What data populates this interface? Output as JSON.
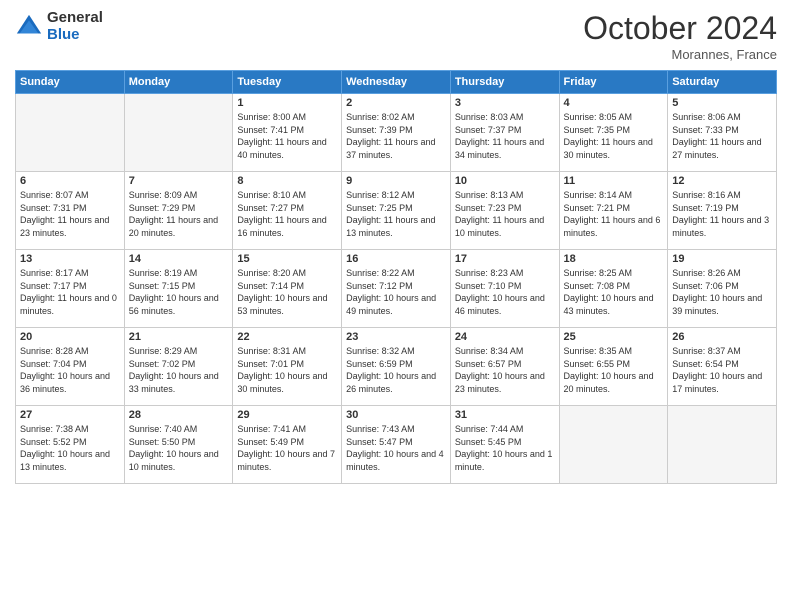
{
  "logo": {
    "general": "General",
    "blue": "Blue"
  },
  "title": "October 2024",
  "location": "Morannes, France",
  "days_header": [
    "Sunday",
    "Monday",
    "Tuesday",
    "Wednesday",
    "Thursday",
    "Friday",
    "Saturday"
  ],
  "weeks": [
    [
      {
        "day": "",
        "sunrise": "",
        "sunset": "",
        "daylight": ""
      },
      {
        "day": "",
        "sunrise": "",
        "sunset": "",
        "daylight": ""
      },
      {
        "day": "1",
        "sunrise": "Sunrise: 8:00 AM",
        "sunset": "Sunset: 7:41 PM",
        "daylight": "Daylight: 11 hours and 40 minutes."
      },
      {
        "day": "2",
        "sunrise": "Sunrise: 8:02 AM",
        "sunset": "Sunset: 7:39 PM",
        "daylight": "Daylight: 11 hours and 37 minutes."
      },
      {
        "day": "3",
        "sunrise": "Sunrise: 8:03 AM",
        "sunset": "Sunset: 7:37 PM",
        "daylight": "Daylight: 11 hours and 34 minutes."
      },
      {
        "day": "4",
        "sunrise": "Sunrise: 8:05 AM",
        "sunset": "Sunset: 7:35 PM",
        "daylight": "Daylight: 11 hours and 30 minutes."
      },
      {
        "day": "5",
        "sunrise": "Sunrise: 8:06 AM",
        "sunset": "Sunset: 7:33 PM",
        "daylight": "Daylight: 11 hours and 27 minutes."
      }
    ],
    [
      {
        "day": "6",
        "sunrise": "Sunrise: 8:07 AM",
        "sunset": "Sunset: 7:31 PM",
        "daylight": "Daylight: 11 hours and 23 minutes."
      },
      {
        "day": "7",
        "sunrise": "Sunrise: 8:09 AM",
        "sunset": "Sunset: 7:29 PM",
        "daylight": "Daylight: 11 hours and 20 minutes."
      },
      {
        "day": "8",
        "sunrise": "Sunrise: 8:10 AM",
        "sunset": "Sunset: 7:27 PM",
        "daylight": "Daylight: 11 hours and 16 minutes."
      },
      {
        "day": "9",
        "sunrise": "Sunrise: 8:12 AM",
        "sunset": "Sunset: 7:25 PM",
        "daylight": "Daylight: 11 hours and 13 minutes."
      },
      {
        "day": "10",
        "sunrise": "Sunrise: 8:13 AM",
        "sunset": "Sunset: 7:23 PM",
        "daylight": "Daylight: 11 hours and 10 minutes."
      },
      {
        "day": "11",
        "sunrise": "Sunrise: 8:14 AM",
        "sunset": "Sunset: 7:21 PM",
        "daylight": "Daylight: 11 hours and 6 minutes."
      },
      {
        "day": "12",
        "sunrise": "Sunrise: 8:16 AM",
        "sunset": "Sunset: 7:19 PM",
        "daylight": "Daylight: 11 hours and 3 minutes."
      }
    ],
    [
      {
        "day": "13",
        "sunrise": "Sunrise: 8:17 AM",
        "sunset": "Sunset: 7:17 PM",
        "daylight": "Daylight: 11 hours and 0 minutes."
      },
      {
        "day": "14",
        "sunrise": "Sunrise: 8:19 AM",
        "sunset": "Sunset: 7:15 PM",
        "daylight": "Daylight: 10 hours and 56 minutes."
      },
      {
        "day": "15",
        "sunrise": "Sunrise: 8:20 AM",
        "sunset": "Sunset: 7:14 PM",
        "daylight": "Daylight: 10 hours and 53 minutes."
      },
      {
        "day": "16",
        "sunrise": "Sunrise: 8:22 AM",
        "sunset": "Sunset: 7:12 PM",
        "daylight": "Daylight: 10 hours and 49 minutes."
      },
      {
        "day": "17",
        "sunrise": "Sunrise: 8:23 AM",
        "sunset": "Sunset: 7:10 PM",
        "daylight": "Daylight: 10 hours and 46 minutes."
      },
      {
        "day": "18",
        "sunrise": "Sunrise: 8:25 AM",
        "sunset": "Sunset: 7:08 PM",
        "daylight": "Daylight: 10 hours and 43 minutes."
      },
      {
        "day": "19",
        "sunrise": "Sunrise: 8:26 AM",
        "sunset": "Sunset: 7:06 PM",
        "daylight": "Daylight: 10 hours and 39 minutes."
      }
    ],
    [
      {
        "day": "20",
        "sunrise": "Sunrise: 8:28 AM",
        "sunset": "Sunset: 7:04 PM",
        "daylight": "Daylight: 10 hours and 36 minutes."
      },
      {
        "day": "21",
        "sunrise": "Sunrise: 8:29 AM",
        "sunset": "Sunset: 7:02 PM",
        "daylight": "Daylight: 10 hours and 33 minutes."
      },
      {
        "day": "22",
        "sunrise": "Sunrise: 8:31 AM",
        "sunset": "Sunset: 7:01 PM",
        "daylight": "Daylight: 10 hours and 30 minutes."
      },
      {
        "day": "23",
        "sunrise": "Sunrise: 8:32 AM",
        "sunset": "Sunset: 6:59 PM",
        "daylight": "Daylight: 10 hours and 26 minutes."
      },
      {
        "day": "24",
        "sunrise": "Sunrise: 8:34 AM",
        "sunset": "Sunset: 6:57 PM",
        "daylight": "Daylight: 10 hours and 23 minutes."
      },
      {
        "day": "25",
        "sunrise": "Sunrise: 8:35 AM",
        "sunset": "Sunset: 6:55 PM",
        "daylight": "Daylight: 10 hours and 20 minutes."
      },
      {
        "day": "26",
        "sunrise": "Sunrise: 8:37 AM",
        "sunset": "Sunset: 6:54 PM",
        "daylight": "Daylight: 10 hours and 17 minutes."
      }
    ],
    [
      {
        "day": "27",
        "sunrise": "Sunrise: 7:38 AM",
        "sunset": "Sunset: 5:52 PM",
        "daylight": "Daylight: 10 hours and 13 minutes."
      },
      {
        "day": "28",
        "sunrise": "Sunrise: 7:40 AM",
        "sunset": "Sunset: 5:50 PM",
        "daylight": "Daylight: 10 hours and 10 minutes."
      },
      {
        "day": "29",
        "sunrise": "Sunrise: 7:41 AM",
        "sunset": "Sunset: 5:49 PM",
        "daylight": "Daylight: 10 hours and 7 minutes."
      },
      {
        "day": "30",
        "sunrise": "Sunrise: 7:43 AM",
        "sunset": "Sunset: 5:47 PM",
        "daylight": "Daylight: 10 hours and 4 minutes."
      },
      {
        "day": "31",
        "sunrise": "Sunrise: 7:44 AM",
        "sunset": "Sunset: 5:45 PM",
        "daylight": "Daylight: 10 hours and 1 minute."
      },
      {
        "day": "",
        "sunrise": "",
        "sunset": "",
        "daylight": ""
      },
      {
        "day": "",
        "sunrise": "",
        "sunset": "",
        "daylight": ""
      }
    ]
  ]
}
